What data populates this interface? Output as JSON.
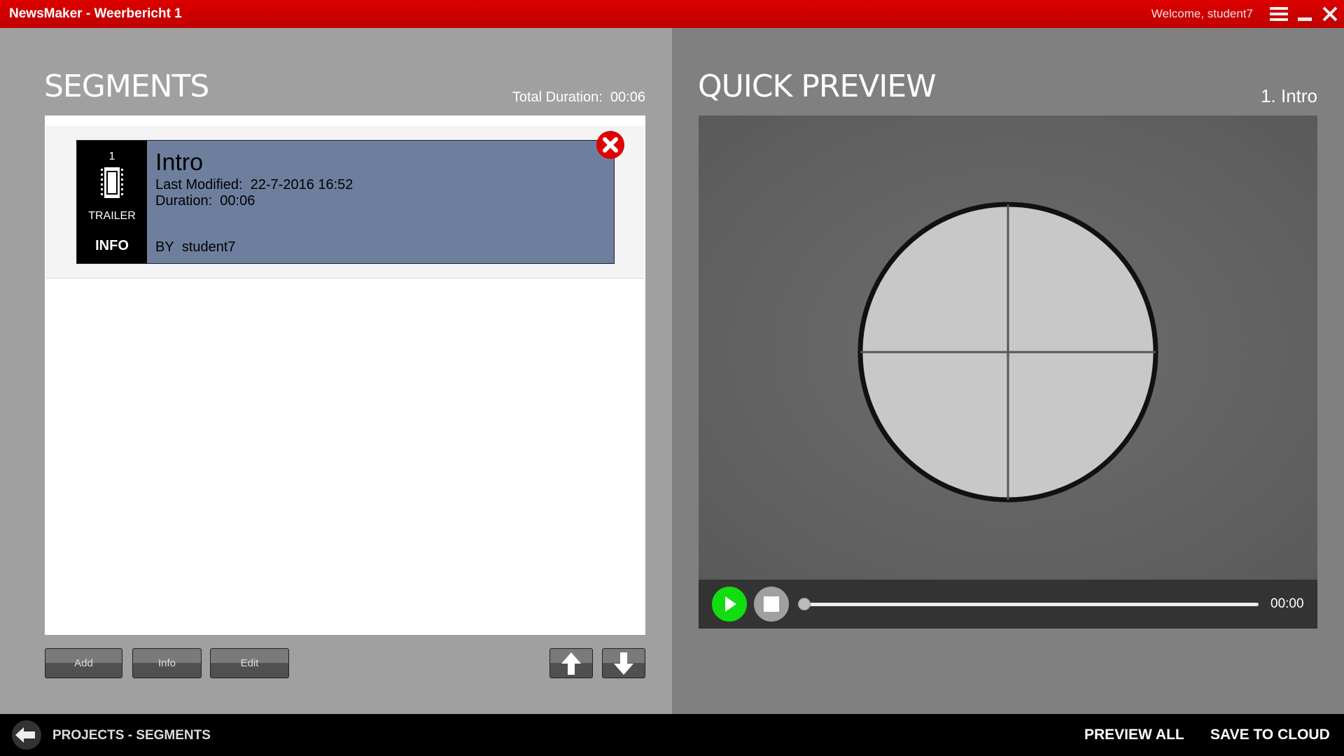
{
  "titlebar": {
    "title": "NewsMaker - Weerbericht 1",
    "welcome": "Welcome, student7"
  },
  "segments": {
    "title": "SEGMENTS",
    "total_duration_label": "Total Duration:",
    "total_duration": "00:06",
    "items": [
      {
        "number": "1",
        "type": "TRAILER",
        "info": "INFO",
        "name": "Intro",
        "last_modified_label": "Last Modified:",
        "last_modified": "22-7-2016 16:52",
        "duration_label": "Duration:",
        "duration": "00:06",
        "by_label": "BY",
        "author": "student7"
      }
    ],
    "buttons": {
      "add": "Add",
      "info": "Info",
      "edit": "Edit"
    }
  },
  "preview": {
    "title": "QUICK PREVIEW",
    "current": "1. Intro",
    "time": "00:00",
    "progress": 0
  },
  "footer": {
    "breadcrumb": [
      "PROJECTS",
      "SEGMENTS"
    ],
    "separator": "-",
    "preview_all": "PREVIEW ALL",
    "save_to_cloud": "SAVE TO CLOUD"
  },
  "colors": {
    "titlebar": "#d40000",
    "card": "#6e7f9e",
    "play": "#11dd11"
  }
}
